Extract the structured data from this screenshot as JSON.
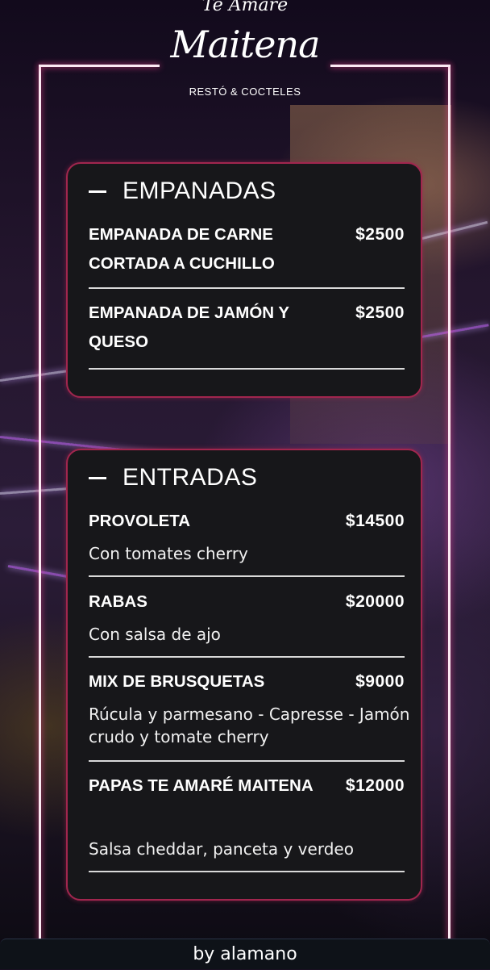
{
  "brand": {
    "script_small": "Te Amaré",
    "script_main": "Maitena",
    "tagline": "RESTÓ & COCTELES"
  },
  "colors": {
    "card_background": "#17171a",
    "card_border": "#a1264e",
    "neon": "#fbe9f2",
    "text": "#ffffff"
  },
  "categories": [
    {
      "title": "EMPANADAS",
      "icon": "minus-icon",
      "items": [
        {
          "name": "EMPANADA DE CARNE CORTADA A CUCHILLO",
          "price": "$2500"
        },
        {
          "name": "EMPANADA DE JAMÓN Y QUESO",
          "price": "$2500"
        }
      ]
    },
    {
      "title": "ENTRADAS",
      "icon": "minus-icon",
      "items": [
        {
          "name": "PROVOLETA",
          "price": "$14500",
          "description": "Con tomates cherry"
        },
        {
          "name": "RABAS",
          "price": "$20000",
          "description": "Con salsa de ajo"
        },
        {
          "name": "MIX DE BRUSQUETAS",
          "price": "$9000",
          "description": "Rúcula y parmesano - Capresse - Jamón crudo y tomate cherry"
        },
        {
          "name": "PAPAS TE AMARÉ MAITENA",
          "price": "$12000",
          "description": "Salsa cheddar, panceta y verdeo"
        }
      ]
    }
  ],
  "footer": {
    "text": "by alamano"
  }
}
